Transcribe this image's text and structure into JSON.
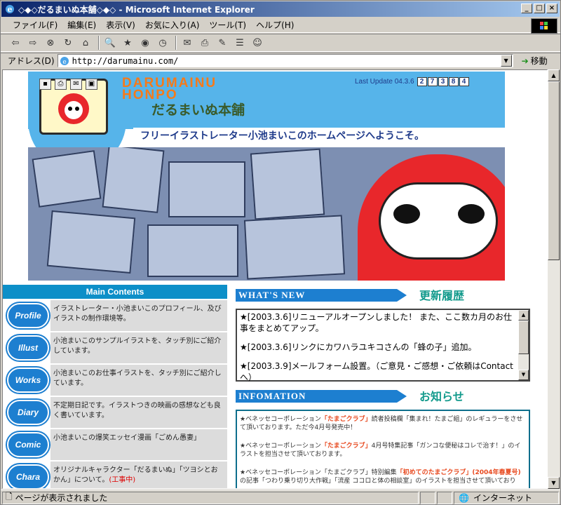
{
  "window": {
    "title": "◇◆◇だるまいぬ本舗◇◆◇ - Microsoft Internet Explorer",
    "buttons": [
      "_",
      "□",
      "×"
    ]
  },
  "menu": [
    "ファイル(F)",
    "編集(E)",
    "表示(V)",
    "お気に入り(A)",
    "ツール(T)",
    "ヘルプ(H)"
  ],
  "address": {
    "label": "アドレス(D)",
    "url": "http://darumainu.com/",
    "go_label": "移動"
  },
  "status": {
    "text": "ページが表示されました",
    "zone": "インターネット"
  },
  "header": {
    "logo_en": "DARUMAINU HONPO",
    "logo_jp": "だるまいぬ本舗",
    "last_update_label": "Last Update 04.3.6",
    "counter": [
      "2",
      "7",
      "3",
      "8",
      "4"
    ],
    "welcome": "フリーイラストレーター小池まいこのホームページへようこそ。"
  },
  "sidebar": {
    "title": "Main Contents",
    "items": [
      {
        "icon": "Profile",
        "text": "イラストレーター・小池まいこのプロフィール、及びイラストの制作環境等。",
        "note": ""
      },
      {
        "icon": "Illust",
        "text": "小池まいこのサンプルイラストを、タッチ別にご紹介しています。",
        "note": ""
      },
      {
        "icon": "Works",
        "text": "小池まいこのお仕事イラストを、タッチ別にご紹介しています。",
        "note": ""
      },
      {
        "icon": "Diary",
        "text": "不定期日記です。イラストつきの映画の感想なども良く書いています。",
        "note": ""
      },
      {
        "icon": "Comic",
        "text": "小池まいこの爆笑エッセイ漫画「ごめん愚妻」",
        "note": ""
      },
      {
        "icon": "Chara",
        "text": "オリジナルキャラクター「だるまいぬ」「ツヨシとおかん」について。",
        "note": "(工事中)"
      }
    ]
  },
  "whats_new": {
    "title_en": "WHAT'S NEW",
    "title_jp": "更新履歴",
    "entries": [
      "★[2003.3.6]リニューアルオープンしました！ また、ここ数カ月のお仕事をまとめてアップ。",
      "★[2003.3.6]リンクにカワハラユキコさんの「蜂の子」追加。",
      "★[2003.3.9]メールフォーム設置。（ご意見・ご感想・ご依頼はContactへ）"
    ]
  },
  "info": {
    "title_en": "INFOMATION",
    "title_jp": "お知らせ",
    "entries": [
      {
        "pre": "★ベネッセコーポレーション",
        "hl": "「たまごクラブ」",
        "post": "読者投稿欄「集まれ！たまご組」のレギュラーをさせて頂いております。ただ今4月号発売中！"
      },
      {
        "pre": "★ベネッセコーポレーション",
        "hl": "「たまごクラブ」",
        "post": "4月号特集記事「ガンコな便秘はコレで治す！」のイラストを担当させて頂いております。"
      },
      {
        "pre": "★ベネッセコーポレーション「たまごクラブ」特別編集",
        "hl": "「初めてのたまごクラブ」(2004年春夏号)",
        "post": "の記事「つわり乗り切り大作戦」「流産 ココロと体の相談室」のイラストを担当させて頂いており"
      }
    ]
  },
  "colors": {
    "title_gradient_start": "#0a246a",
    "header_blue": "#56b4ea",
    "accent_orange": "#f57a1a",
    "section_blue": "#1d7fd0",
    "section_teal": "#129a8c",
    "daruma_red": "#e8272b"
  }
}
